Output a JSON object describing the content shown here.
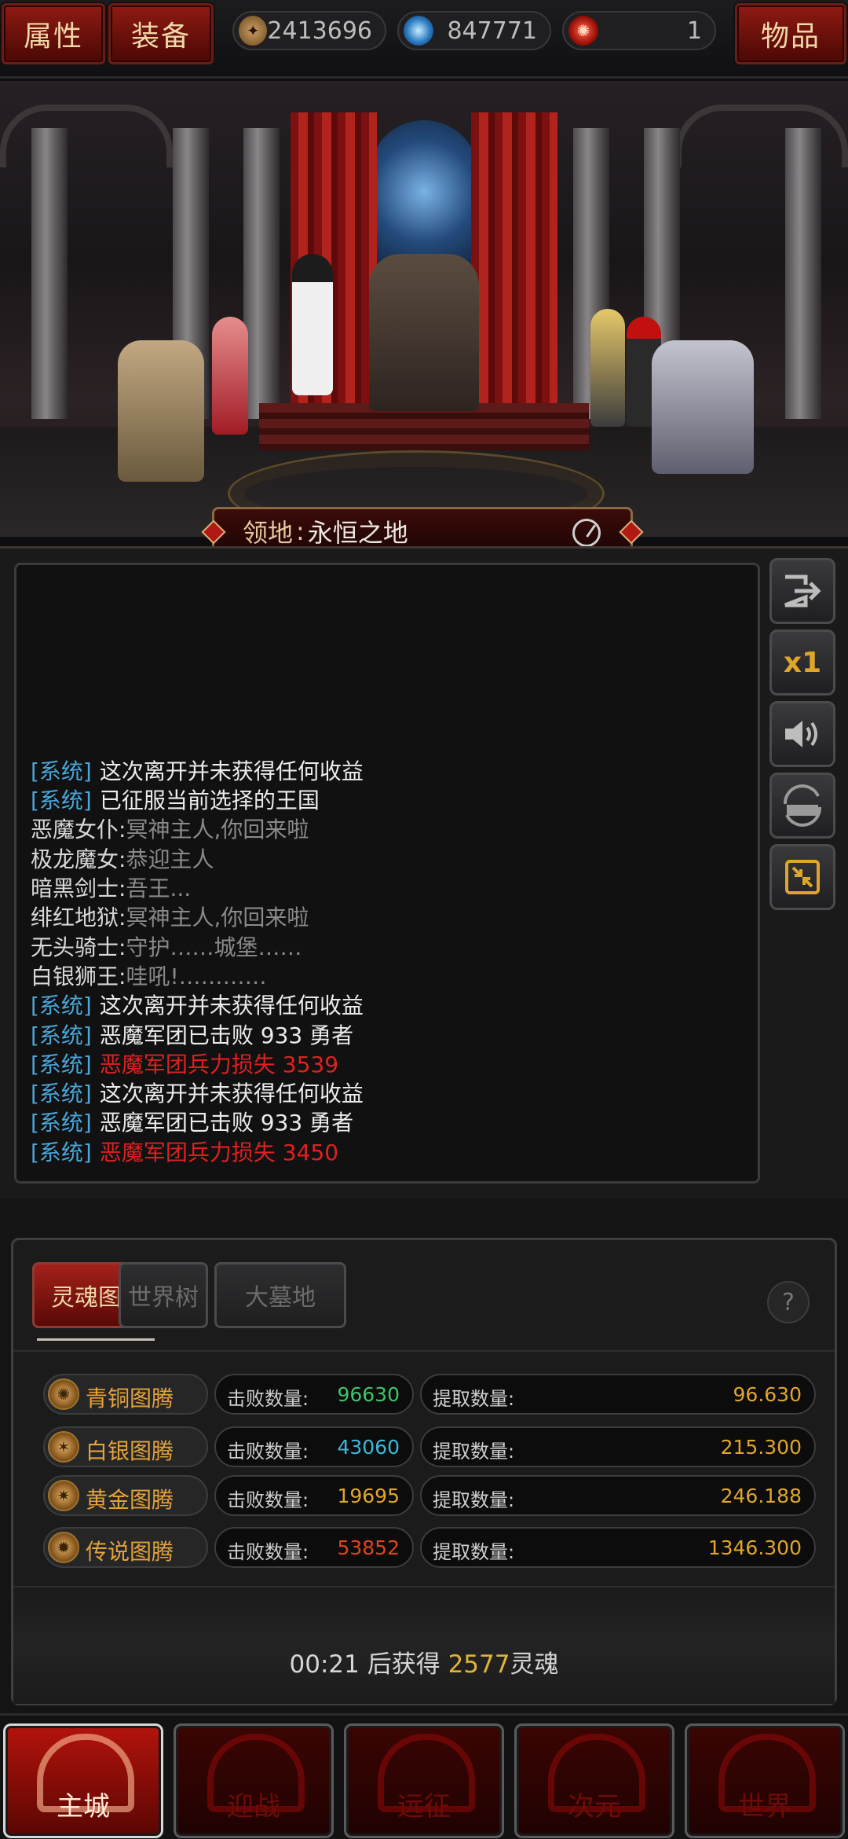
{
  "topbar": {
    "left_buttons": [
      "属性",
      "装备"
    ],
    "resources": [
      {
        "icon": "bronze-coin-icon",
        "value": "2413696"
      },
      {
        "icon": "blue-orb-icon",
        "value": "847771"
      },
      {
        "icon": "red-emblem-icon",
        "value": "1"
      }
    ],
    "right_button": "物品"
  },
  "scene": {
    "zone_label": "领地",
    "zone_sep": ":",
    "zone_value": "永恒之地"
  },
  "log": [
    {
      "tag": "[系统]",
      "text": "这次离开并未获得任何收益",
      "kind": "sys"
    },
    {
      "tag": "[系统]",
      "text": "已征服当前选择的王国",
      "kind": "sys"
    },
    {
      "speaker": "恶魔女仆:",
      "text": "冥神主人,你回来啦",
      "kind": "speech"
    },
    {
      "speaker": "极龙魔女:",
      "text": "恭迎主人",
      "kind": "speech"
    },
    {
      "speaker": "暗黑剑士:",
      "text": "吾王...",
      "kind": "speech"
    },
    {
      "speaker": "绯红地狱:",
      "text": "冥神主人,你回来啦",
      "kind": "speech"
    },
    {
      "speaker": "无头骑士:",
      "text": "守护……城堡……",
      "kind": "speech"
    },
    {
      "speaker": "白银狮王:",
      "text": "哇吼!…………",
      "kind": "speech"
    },
    {
      "tag": "[系统]",
      "text": "这次离开并未获得任何收益",
      "kind": "sys"
    },
    {
      "tag": "[系统]",
      "text": "恶魔军团已击败 933 勇者",
      "kind": "sys"
    },
    {
      "tag": "[系统]",
      "text": "恶魔军团兵力损失 3539",
      "kind": "warn"
    },
    {
      "tag": "[系统]",
      "text": "这次离开并未获得任何收益",
      "kind": "sys"
    },
    {
      "tag": "[系统]",
      "text": "恶魔军团已击败 933 勇者",
      "kind": "sys"
    },
    {
      "tag": "[系统]",
      "text": "恶魔军团兵力损失 3450",
      "kind": "warn"
    }
  ],
  "side_buttons": [
    {
      "name": "exit-icon",
      "label": ""
    },
    {
      "name": "speed-toggle",
      "label": "x1"
    },
    {
      "name": "sound-icon",
      "label": ""
    },
    {
      "name": "auto-icon",
      "label": ""
    },
    {
      "name": "collapse-icon",
      "label": ""
    }
  ],
  "totem": {
    "tabs": [
      "灵魂图腾",
      "世界树",
      "大墓地"
    ],
    "help": "?",
    "kill_label": "击败数量:",
    "draw_label": "提取数量:",
    "rows": [
      {
        "name": "青铜图腾",
        "kills": "96630",
        "kills_color": "#3fc46a",
        "draw": "96.630"
      },
      {
        "name": "白银图腾",
        "kills": "43060",
        "kills_color": "#3bb8d8",
        "draw": "215.300"
      },
      {
        "name": "黄金图腾",
        "kills": "19695",
        "kills_color": "#e0a62a",
        "draw": "246.188"
      },
      {
        "name": "传说图腾",
        "kills": "53852",
        "kills_color": "#e0431f",
        "draw": "1346.300"
      }
    ],
    "draw_color": "#e0a62a",
    "timer": "00:21",
    "timer_mid": " 后获得 ",
    "timer_amount": "2577",
    "timer_unit": "灵魂"
  },
  "nav": [
    "主城",
    "迎战",
    "远征",
    "次元",
    "世界"
  ]
}
